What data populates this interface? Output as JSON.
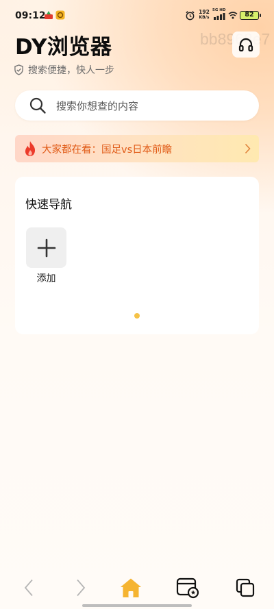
{
  "status_bar": {
    "time": "09:12",
    "net_speed_value": "192",
    "net_speed_unit": "KB/s",
    "signal_label": "5G HD",
    "battery": "82"
  },
  "header": {
    "title": "DY浏览器",
    "watermark": "bb8968e7",
    "slogan": "搜索便捷，快人一步"
  },
  "search": {
    "placeholder": "搜索你想查的内容"
  },
  "trending": {
    "text": "大家都在看：国足vs日本前瞻"
  },
  "quick_nav": {
    "title": "快速导航",
    "add_label": "添加"
  },
  "colors": {
    "accent": "#f5c247",
    "trending_text": "#e05a16",
    "home_icon": "#f5b431"
  },
  "icons": {
    "search": "search-icon",
    "headphone": "headphone-icon",
    "shield": "shield-check-icon",
    "flame": "flame-icon",
    "plus": "plus-icon",
    "back": "chevron-left-icon",
    "forward": "chevron-right-icon",
    "home": "home-icon",
    "tabs": "tabs-icon",
    "bookmarks": "bookmark-window-icon"
  }
}
